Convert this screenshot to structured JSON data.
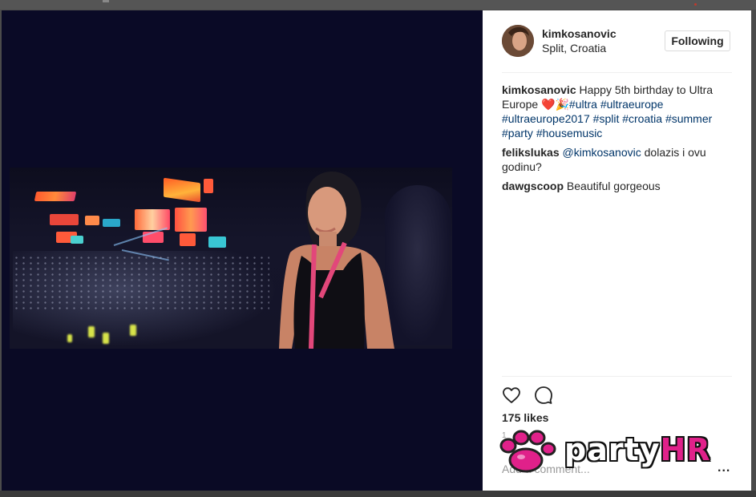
{
  "post": {
    "username": "kimkosanovic",
    "location": "Split, Croatia",
    "follow_label": "Following",
    "comments": [
      {
        "user": "kimkosanovic",
        "text": "Happy 5th birthday to Ultra Europe",
        "emoji": "❤️🎉",
        "tags": [
          "#ultra",
          "#ultraeurope",
          "#ultraeurope2017",
          "#split",
          "#croatia",
          "#summer",
          "#party",
          "#housemusic"
        ]
      },
      {
        "user": "felikslukas",
        "mention": "@kimkosanovic",
        "text": "dolazis i ovu godinu?"
      },
      {
        "user": "dawgscoop",
        "text": "Beautiful gorgeous"
      }
    ],
    "likes": "175 likes",
    "time_partial": "1",
    "add_comment_placeholder": "Add a comment...",
    "more_label": "..."
  },
  "watermark": {
    "text_main": "party",
    "text_accent": "HR"
  },
  "colors": {
    "hashtag": "#003569",
    "accent_pink": "#e0218a"
  }
}
